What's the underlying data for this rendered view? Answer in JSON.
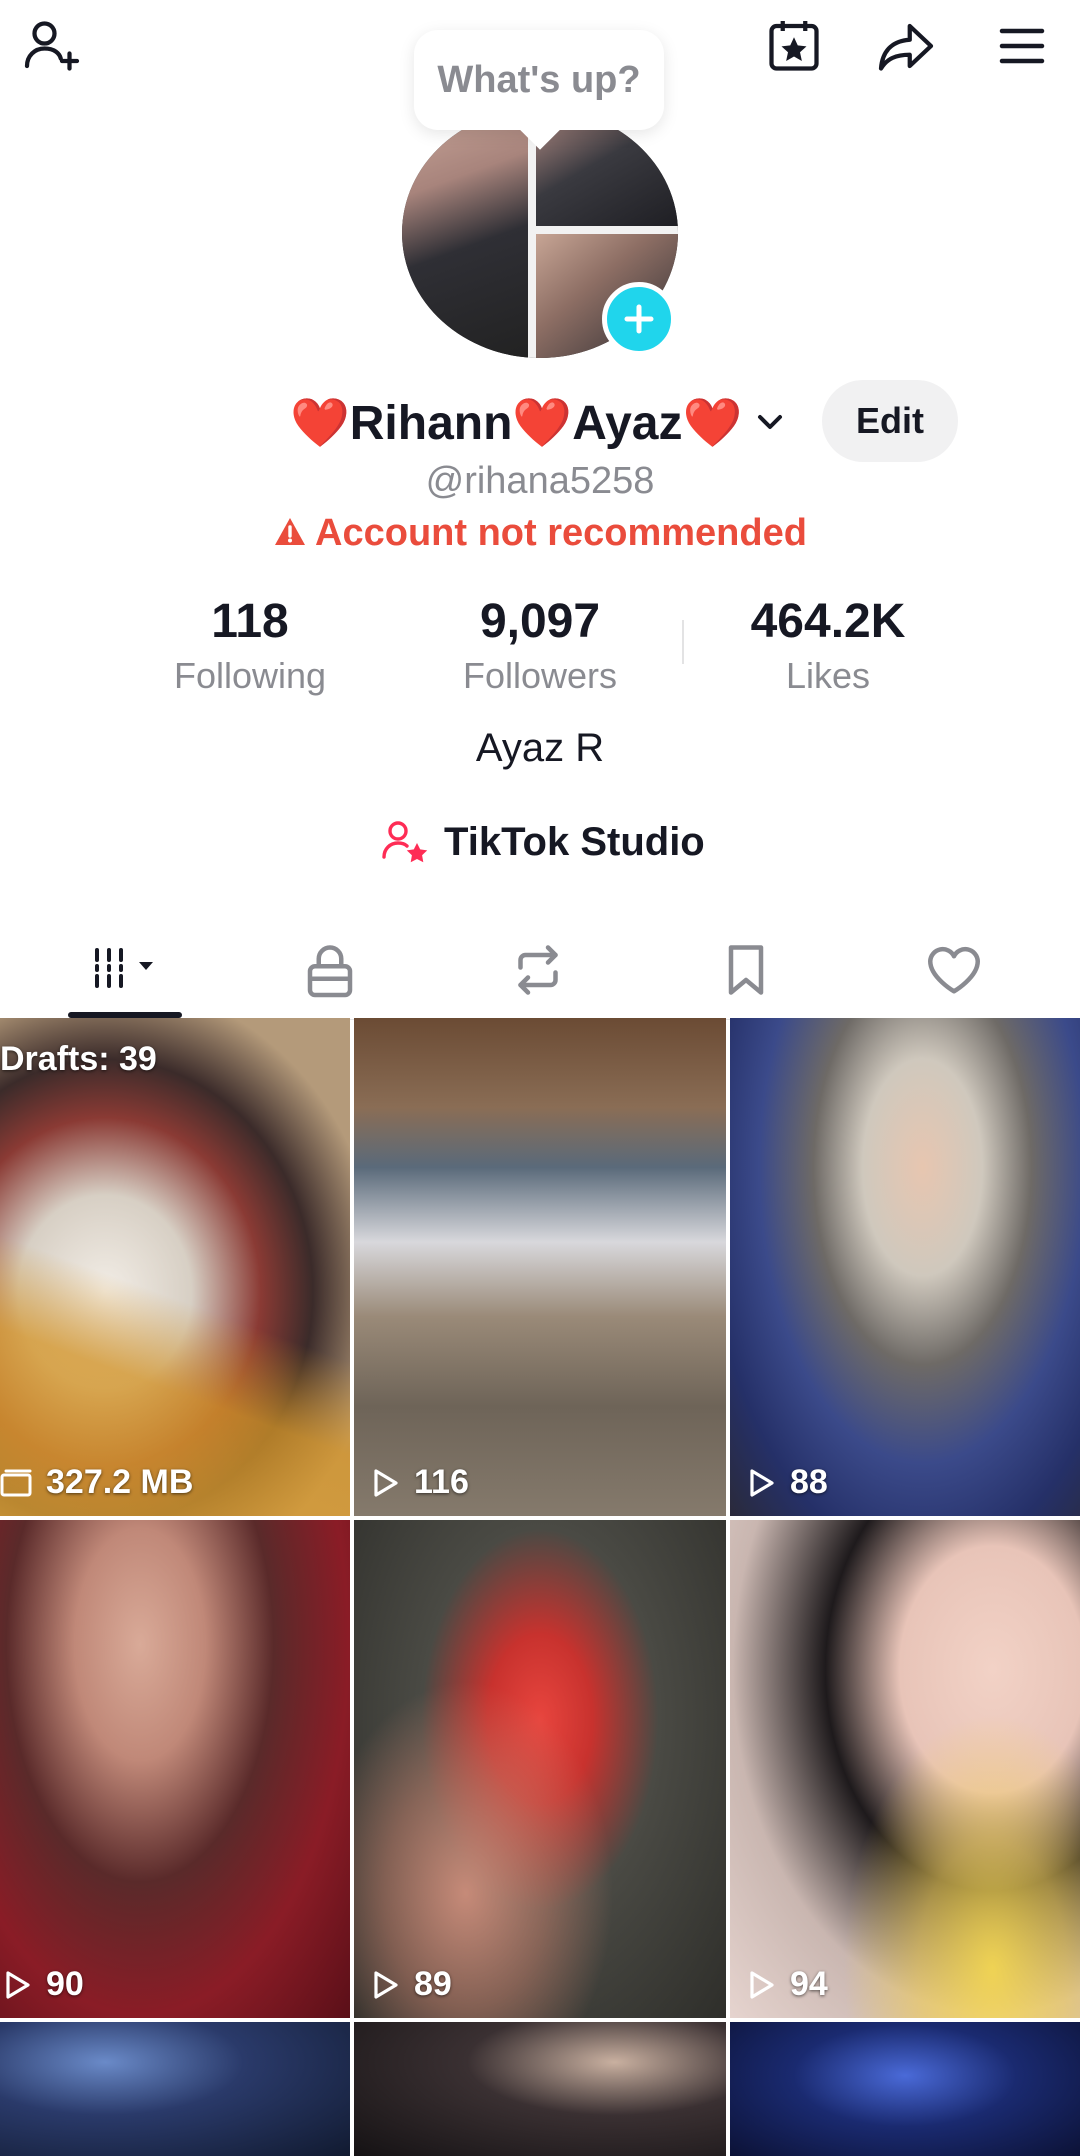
{
  "header": {
    "status_bubble": "What's up?"
  },
  "profile": {
    "name_parts": [
      "❤️",
      "Rihann",
      "❤️",
      "Ayaz",
      "❤️"
    ],
    "edit_label": "Edit",
    "handle": "@rihana5258",
    "warning": "Account not recommended",
    "bio": "Ayaz R",
    "studio_label": "TikTok Studio"
  },
  "stats": [
    {
      "value": "118",
      "label": "Following"
    },
    {
      "value": "9,097",
      "label": "Followers"
    },
    {
      "value": "464.2K",
      "label": "Likes"
    }
  ],
  "tabs": [
    {
      "icon": "videos-grid-icon"
    },
    {
      "icon": "lock-icon"
    },
    {
      "icon": "repost-icon"
    },
    {
      "icon": "bookmark-icon"
    },
    {
      "icon": "heart-icon"
    }
  ],
  "grid": {
    "drafts_label": "Drafts: 39",
    "items": [
      {
        "label": "327.2 MB",
        "icon": "drafts-icon"
      },
      {
        "label": "116",
        "icon": "play-icon"
      },
      {
        "label": "88",
        "icon": "play-icon"
      },
      {
        "label": "90",
        "icon": "play-icon"
      },
      {
        "label": "89",
        "icon": "play-icon"
      },
      {
        "label": "94",
        "icon": "play-icon"
      }
    ]
  },
  "colors": {
    "accent_cyan": "#20d5ec",
    "warning_red": "#ea4c3c",
    "studio_pink": "#fe2c55",
    "text_primary": "#161823",
    "text_secondary": "#8a8b91"
  }
}
